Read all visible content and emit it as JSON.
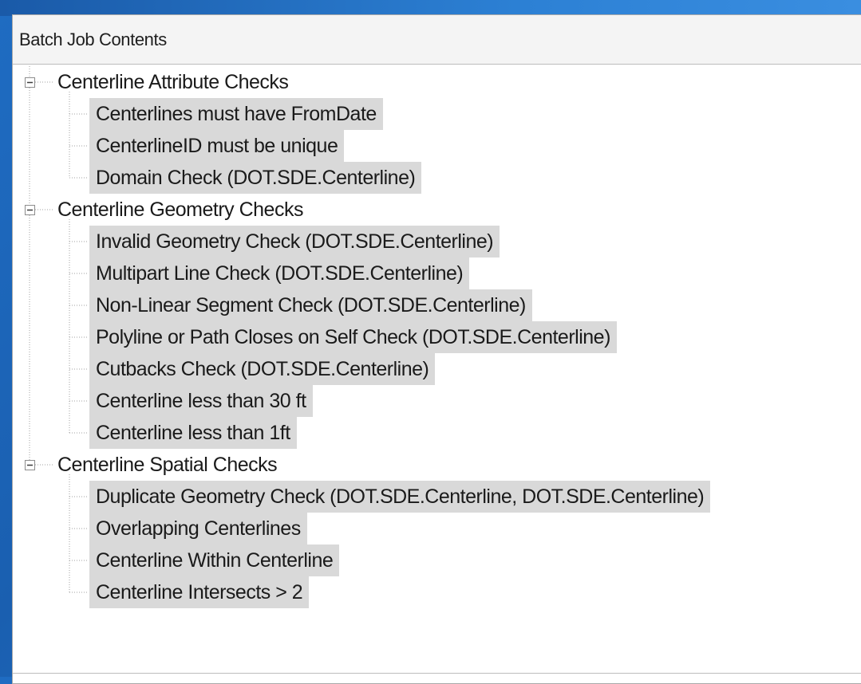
{
  "panel": {
    "title": "Batch Job Contents"
  },
  "groups": [
    {
      "label": "Centerline Attribute Checks",
      "expand_glyph": "minus",
      "items": [
        "Centerlines must have FromDate",
        "CenterlineID must be unique",
        "Domain Check (DOT.SDE.Centerline)"
      ]
    },
    {
      "label": "Centerline Geometry Checks",
      "expand_glyph": "minus",
      "items": [
        "Invalid Geometry Check (DOT.SDE.Centerline)",
        "Multipart Line Check (DOT.SDE.Centerline)",
        "Non-Linear Segment Check (DOT.SDE.Centerline)",
        "Polyline or Path Closes on Self Check (DOT.SDE.Centerline)",
        "Cutbacks Check (DOT.SDE.Centerline)",
        "Centerline less than 30 ft",
        "Centerline less than 1ft"
      ]
    },
    {
      "label": "Centerline Spatial Checks",
      "expand_glyph": "minus",
      "items": [
        "Duplicate Geometry Check (DOT.SDE.Centerline, DOT.SDE.Centerline)",
        "Overlapping Centerlines",
        "Centerline Within Centerline",
        "Centerline Intersects > 2"
      ]
    }
  ],
  "colors": {
    "selection_bg": "#d9d9d9",
    "tree_line": "#a0a0a0",
    "background_blue": "#1f6cc2"
  }
}
